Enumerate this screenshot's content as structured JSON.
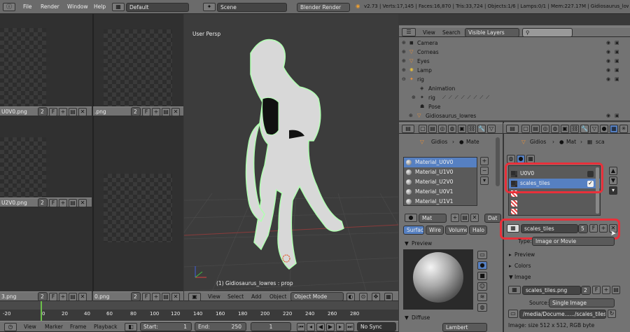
{
  "topbar": {
    "menu": [
      "File",
      "Render",
      "Window",
      "Help"
    ],
    "layout": "Default",
    "scene": "Scene",
    "engine": "Blender Render",
    "stats": "v2.73 | Verts:17,145 | Faces:16,870 | Tris:33,724 | Objects:1/6 | Lamps:0/1 | Mem:227.17M | Gidiosaurus_lowres"
  },
  "image_editors": [
    {
      "name": "U0V0.png",
      "users": "2"
    },
    {
      "name": ".png",
      "users": "2"
    },
    {
      "name": "U2V0.png",
      "users": "2"
    },
    {
      "name": "3.png",
      "users": "2"
    },
    {
      "name": "0.png",
      "users": "2"
    },
    {
      "name": ".png",
      "users": "2"
    }
  ],
  "viewport": {
    "label": "User Persp",
    "object_label": "(1) Gidiosaurus_lowres : prop",
    "menu": [
      "View",
      "Select",
      "Add",
      "Object"
    ],
    "mode": "Object Mode"
  },
  "timeline": {
    "ticks": [
      "-20",
      "0",
      "20",
      "40",
      "60",
      "80",
      "100",
      "120",
      "140",
      "160",
      "180",
      "200",
      "220",
      "240",
      "260",
      "280"
    ],
    "menu": [
      "View",
      "Marker",
      "Frame",
      "Playback"
    ],
    "start_label": "Start:",
    "start": "1",
    "end_label": "End:",
    "end": "250",
    "current": "1",
    "sync": "No Sync"
  },
  "outliner": {
    "menu": [
      "View",
      "Search"
    ],
    "filter": "Visible Layers",
    "rows": [
      {
        "label": "Camera",
        "indent": 0
      },
      {
        "label": "Corneas",
        "indent": 0
      },
      {
        "label": "Eyes",
        "indent": 0
      },
      {
        "label": "Lamp",
        "indent": 0
      },
      {
        "label": "rig",
        "indent": 0
      },
      {
        "label": "Animation",
        "indent": 2
      },
      {
        "label": "rig",
        "indent": 2
      },
      {
        "label": "Pose",
        "indent": 2
      },
      {
        "label": "Gidiosaurus_lowres",
        "indent": 1
      }
    ]
  },
  "material_panel": {
    "breadcrumb": [
      "Gidios",
      "Mate"
    ],
    "materials": [
      "Material_U0V0",
      "Material_U1V0",
      "Material_U2V0",
      "Material_U0V1",
      "Material_U1V1"
    ],
    "mat_button": "Mat",
    "data_button": "Dat",
    "tabs": [
      "Surface",
      "Wire",
      "Volume",
      "Halo"
    ],
    "preview_label": "Preview",
    "diffuse_label": "Diffuse",
    "diffuse_shader": "Lambert"
  },
  "texture_panel": {
    "breadcrumb": [
      "Gidios",
      "Mat",
      "sca"
    ],
    "slots": [
      "U0V0",
      "scales_tiles",
      "",
      "",
      ""
    ],
    "texture_name": "scales_tiles",
    "texture_users": "5",
    "texture_fake": "F",
    "type_label": "Type:",
    "type_value": "Image or Movie",
    "sections": [
      "Preview",
      "Colors",
      "Image"
    ],
    "image_name": "scales_tiles.png",
    "image_users": "2",
    "image_fake": "F",
    "source_label": "Source:",
    "source_value": "Single Image",
    "filepath": "/media/Docume....../scales_tiles.png",
    "image_info": "Image: size 512 x 512, RGB byte"
  },
  "colors": {
    "highlight": "#e8303a",
    "selected": "#5680c2",
    "wire": "#b0ffb0"
  }
}
